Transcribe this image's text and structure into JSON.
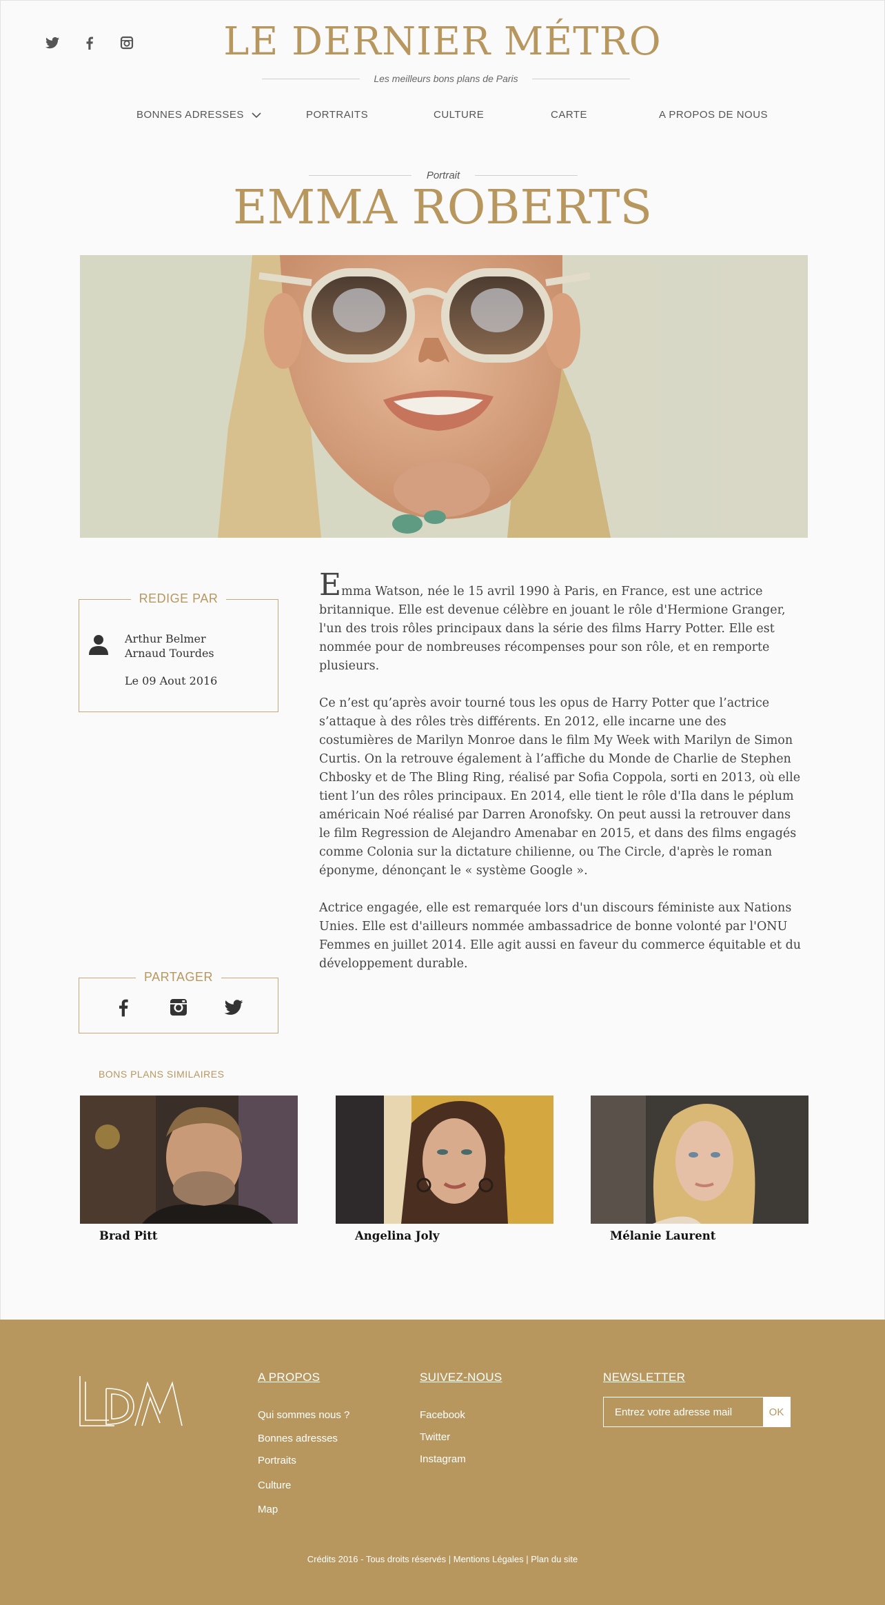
{
  "header": {
    "social_icons": [
      "twitter-icon",
      "facebook-icon",
      "instagram-icon"
    ],
    "site_title": "LE DERNIER MÉTRO",
    "tagline": "Les meilleurs bons plans de Paris"
  },
  "nav": {
    "items": [
      "BONNES ADRESSES",
      "PORTRAITS",
      "CULTURE",
      "CARTE",
      "A PROPOS DE NOUS"
    ],
    "dropdown_icon": "chevron-down-icon"
  },
  "article": {
    "kicker": "Portrait",
    "title": "EMMA ROBERTS",
    "dropcap": "E",
    "p1_rest": "mma Watson, née le 15 avril 1990 à Paris, en France, est une actrice britannique. Elle est devenue célèbre en jouant le rôle d'Hermione Granger, l'un des trois rôles principaux dans la série des films Harry Potter. Elle est nommée pour de nombreuses récompenses pour son rôle, et en remporte plusieurs.",
    "p2": "Ce n’est qu’après avoir tourné tous les opus de Harry Potter que l’actrice s’attaque à des rôles très différents. En 2012, elle incarne une des costumières de Marilyn Monroe dans le film My Week with Marilyn de Simon Curtis. On la retrouve également à l’affiche du Monde de Charlie de Stephen Chbosky et de The Bling Ring, réalisé par Sofia Coppola, sorti en 2013, où elle tient l’un des rôles principaux. En 2014, elle tient le rôle d'Ila dans le péplum américain Noé réalisé par Darren Aronofsky. On peut aussi la retrouver dans le film Regression de Alejandro Amenabar en 2015, et dans des films engagés comme Colonia sur la dictature chilienne, ou The Circle, d'après le roman éponyme, dénonçant le « système Google ».",
    "p3": "Actrice engagée, elle est remarquée lors d'un discours féministe aux Nations Unies. Elle est d'ailleurs nommée ambassadrice de bonne volonté par l'ONU Femmes en juillet 2014. Elle agit aussi en faveur du commerce équitable et du développement durable."
  },
  "author_box": {
    "title": "REDIGE PAR",
    "author1": "Arthur Belmer",
    "author2": "Arnaud Tourdes",
    "date": "Le 09 Aout 2016"
  },
  "share_box": {
    "title": "PARTAGER",
    "icons": [
      "facebook-icon",
      "instagram-icon",
      "twitter-icon"
    ]
  },
  "similar": {
    "label": "BONS PLANS SIMILAIRES",
    "cards": [
      {
        "name": "Brad Pitt"
      },
      {
        "name": "Angelina Joly"
      },
      {
        "name": "Mélanie Laurent"
      }
    ]
  },
  "footer": {
    "logo_text": "LDM",
    "apropos_title": "A PROPOS",
    "apropos_links": [
      "Qui sommes nous ?",
      "Bonnes adresses",
      "Portraits",
      "Culture",
      "Map"
    ],
    "suivez_title": "SUIVEZ-NOUS",
    "suivez_links": [
      "Facebook",
      "Twitter",
      "Instagram"
    ],
    "newsletter_title": "NEWSLETTER",
    "newsletter_placeholder": "Entrez votre adresse mail",
    "newsletter_button": "OK",
    "credits": "Crédits 2016 - Tous droits réservés | Mentions Légales | Plan du site"
  },
  "colors": {
    "accent": "#b8975f",
    "background": "#fafafa",
    "text": "#444444"
  }
}
